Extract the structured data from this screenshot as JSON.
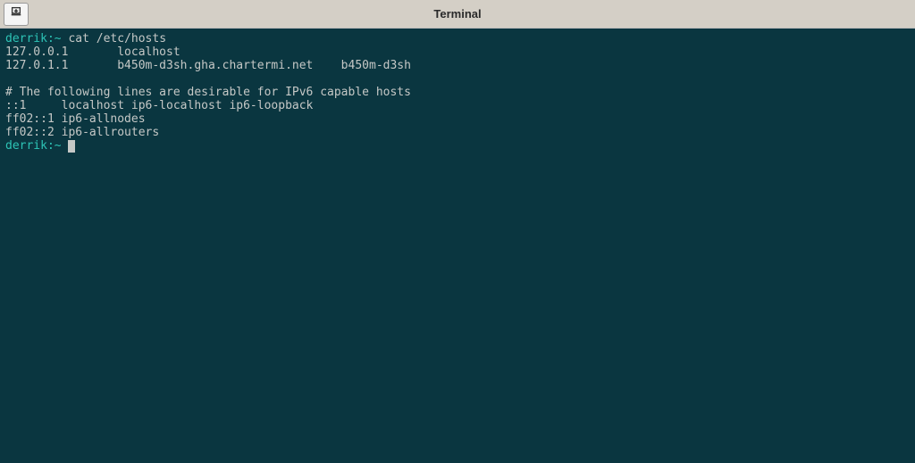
{
  "titlebar": {
    "title": "Terminal"
  },
  "terminal": {
    "prompt1_user": "derrik:",
    "prompt1_tilde": "~",
    "command1": " cat /etc/hosts",
    "output_lines": [
      "127.0.0.1       localhost",
      "127.0.1.1       b450m-d3sh.gha.chartermi.net    b450m-d3sh",
      "",
      "# The following lines are desirable for IPv6 capable hosts",
      "::1     localhost ip6-localhost ip6-loopback",
      "ff02::1 ip6-allnodes",
      "ff02::2 ip6-allrouters"
    ],
    "prompt2_user": "derrik:",
    "prompt2_tilde": "~",
    "command2": " "
  },
  "colors": {
    "terminal_bg": "#0a3640",
    "prompt": "#2dc4b6",
    "text": "#c5c8c6",
    "titlebar_bg": "#d4cfc6"
  }
}
